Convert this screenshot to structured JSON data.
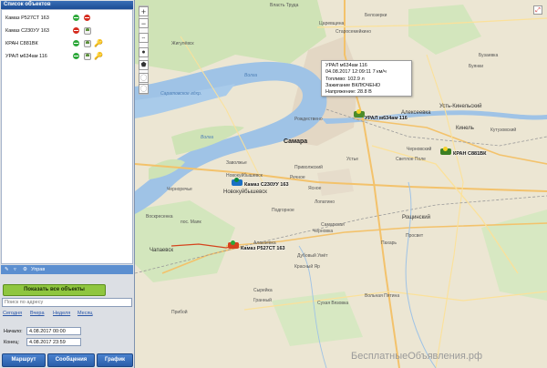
{
  "panel": {
    "title": "Список объектов",
    "objects": [
      {
        "name": "Камаз Р527СТ 163",
        "status_color": "#2da83a",
        "second_icon": "stop-icon"
      },
      {
        "name": "Камаз С230УУ 163",
        "status_color": "#d52c1f",
        "second_icon": "driver-icon"
      },
      {
        "name": "КРАН С881ВК",
        "status_color": "#2da83a",
        "second_icon": "driver-icon",
        "key": true
      },
      {
        "name": "УРАЛ м634ам 116",
        "status_color": "#2da83a",
        "second_icon": "driver-icon",
        "key": true
      }
    ],
    "list_toolbar": {
      "manage": "Управ"
    },
    "show_all_button": "Показать все объекты",
    "address_placeholder": "Поиск по адресу",
    "period_links": [
      "Сегодня",
      "Вчера",
      "Неделя",
      "Месяц"
    ],
    "start_label": "Начало:",
    "start_value": "4.08.2017 00:00",
    "end_label": "Конец:",
    "end_value": "4.08.2017 23:59",
    "buttons": {
      "route": "Маршрут",
      "messages": "Сообщения",
      "graph": "График"
    }
  },
  "map": {
    "cities": {
      "samara": "Самара",
      "novokuibyshevsk": "Новокуйбышевск",
      "chapaevsk": "Чапаевск",
      "roshchinsky": "Рощинский",
      "kinel": "Кинель",
      "ust_kinelsky": "Усть-Кинельский",
      "alekseevka": "Алексеевка"
    },
    "places": [
      "Власть Труда",
      "Белозерки",
      "Царевщина",
      "Старосемейкино",
      "Буянки",
      "Черновский",
      "Светлое Поле",
      "Устье",
      "Кутузовский",
      "Бузаевка",
      "Рождествено",
      "Жигулёвск",
      "Заволжье",
      "Приволжский",
      "Речное",
      "Черноречье",
      "Лопатино",
      "Ясное",
      "Сухая Вязовка",
      "Подгорное",
      "Пахарь",
      "Черновка",
      "Прибой",
      "Самарская",
      "Воскресенка",
      "Алакаевка",
      "Новокуйбышевск",
      "Дубовый Умёт",
      "Просвет",
      "Красный Яр",
      "Сырейка",
      "Гранный",
      "пос. Маяк",
      "Вольная Пятина"
    ],
    "water_labels": [
      "Саратовское вдхр.",
      "Волга",
      "Волга"
    ],
    "vehicles": [
      {
        "label": "УРАЛ м634ам 116",
        "color": "#4c8b2a"
      },
      {
        "label": "КРАН С881ВК",
        "color": "#3b7f23"
      },
      {
        "label": "Камаз С230УУ 163",
        "color": "#1a6fc4"
      },
      {
        "label": "Камаз Р527СТ 163",
        "color": "#d5431d"
      }
    ],
    "popup": {
      "line1": "УРАЛ м634ам 116",
      "line2": "04.08.2017 12:09:11 7 км/ч",
      "line3": "Топливо: 102.9 л",
      "line4": "Зажигание ВКЛЮЧЕНО",
      "line5": "Напряжение: 28.8 В"
    },
    "zoom_in": "+",
    "zoom_out": "−",
    "fullscreen": "⤢",
    "watermark": "БесплатныеОбъявления.рф"
  }
}
